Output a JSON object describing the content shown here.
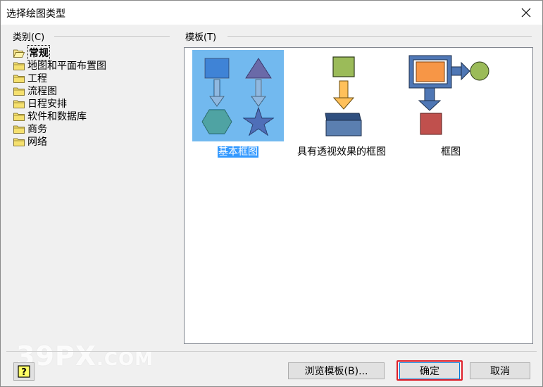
{
  "window": {
    "title": "选择绘图类型"
  },
  "category": {
    "label": "类别(C)",
    "items": [
      {
        "label": "常规",
        "selected": true
      },
      {
        "label": "地图和平面布置图",
        "selected": false
      },
      {
        "label": "工程",
        "selected": false
      },
      {
        "label": "流程图",
        "selected": false
      },
      {
        "label": "日程安排",
        "selected": false
      },
      {
        "label": "软件和数据库",
        "selected": false
      },
      {
        "label": "商务",
        "selected": false
      },
      {
        "label": "网络",
        "selected": false
      }
    ]
  },
  "templates": {
    "label": "模板(T)",
    "items": [
      {
        "label": "基本框图",
        "selected": true
      },
      {
        "label": "具有透视效果的框图",
        "selected": false
      },
      {
        "label": "框图",
        "selected": false
      }
    ]
  },
  "buttons": {
    "browse": "浏览模板(B)...",
    "ok": "确定",
    "cancel": "取消"
  },
  "watermark": {
    "text": "39PX",
    "suffix": ".COM"
  },
  "icons": {
    "close": "close-icon",
    "help": "help-icon",
    "folder": "folder-icon"
  },
  "colors": {
    "highlight": "#e0202a",
    "selection": "#3399ff",
    "accent": "#0078d7"
  }
}
